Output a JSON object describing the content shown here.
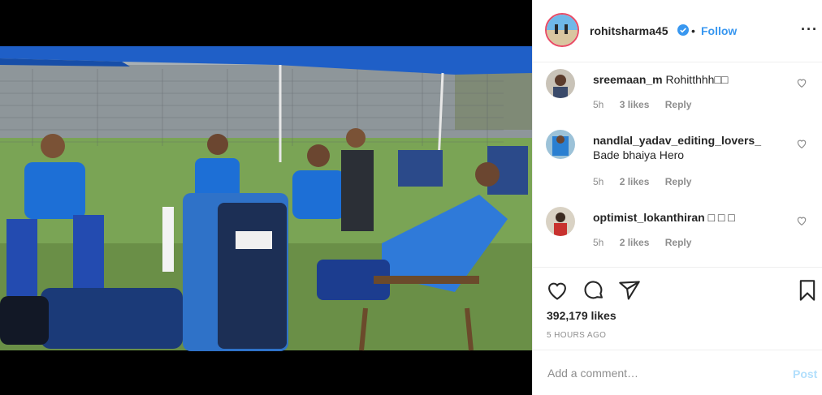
{
  "post": {
    "username": "rohitsharma45",
    "verified": true,
    "dot": "•",
    "follow_label": "Follow",
    "more_label": "···",
    "photo_icon": "cricket-team-photo",
    "likes": "392,179 likes",
    "time_ago": "5 HOURS AGO"
  },
  "comments": [
    {
      "username": "sreemaan_m",
      "text": "Rohitthhh□□",
      "time": "5h",
      "likes": "3 likes",
      "reply": "Reply"
    },
    {
      "username": "nandlal_yadav_editing_lovers_",
      "text": "Bade bhaiya Hero",
      "time": "5h",
      "likes": "2 likes",
      "reply": "Reply"
    },
    {
      "username": "optimist_lokanthiran",
      "text": "□ □ □",
      "time": "5h",
      "likes": "2 likes",
      "reply": "Reply"
    }
  ],
  "add_comment": {
    "placeholder": "Add a comment…",
    "post_label": "Post"
  },
  "colors": {
    "accent": "#3897f0",
    "post_disabled": "#b2dffc",
    "story_ring": "#e94b65"
  },
  "icons": [
    "heart-icon",
    "comment-icon",
    "share-icon",
    "bookmark-icon",
    "verified-badge-icon",
    "more-options-icon"
  ]
}
